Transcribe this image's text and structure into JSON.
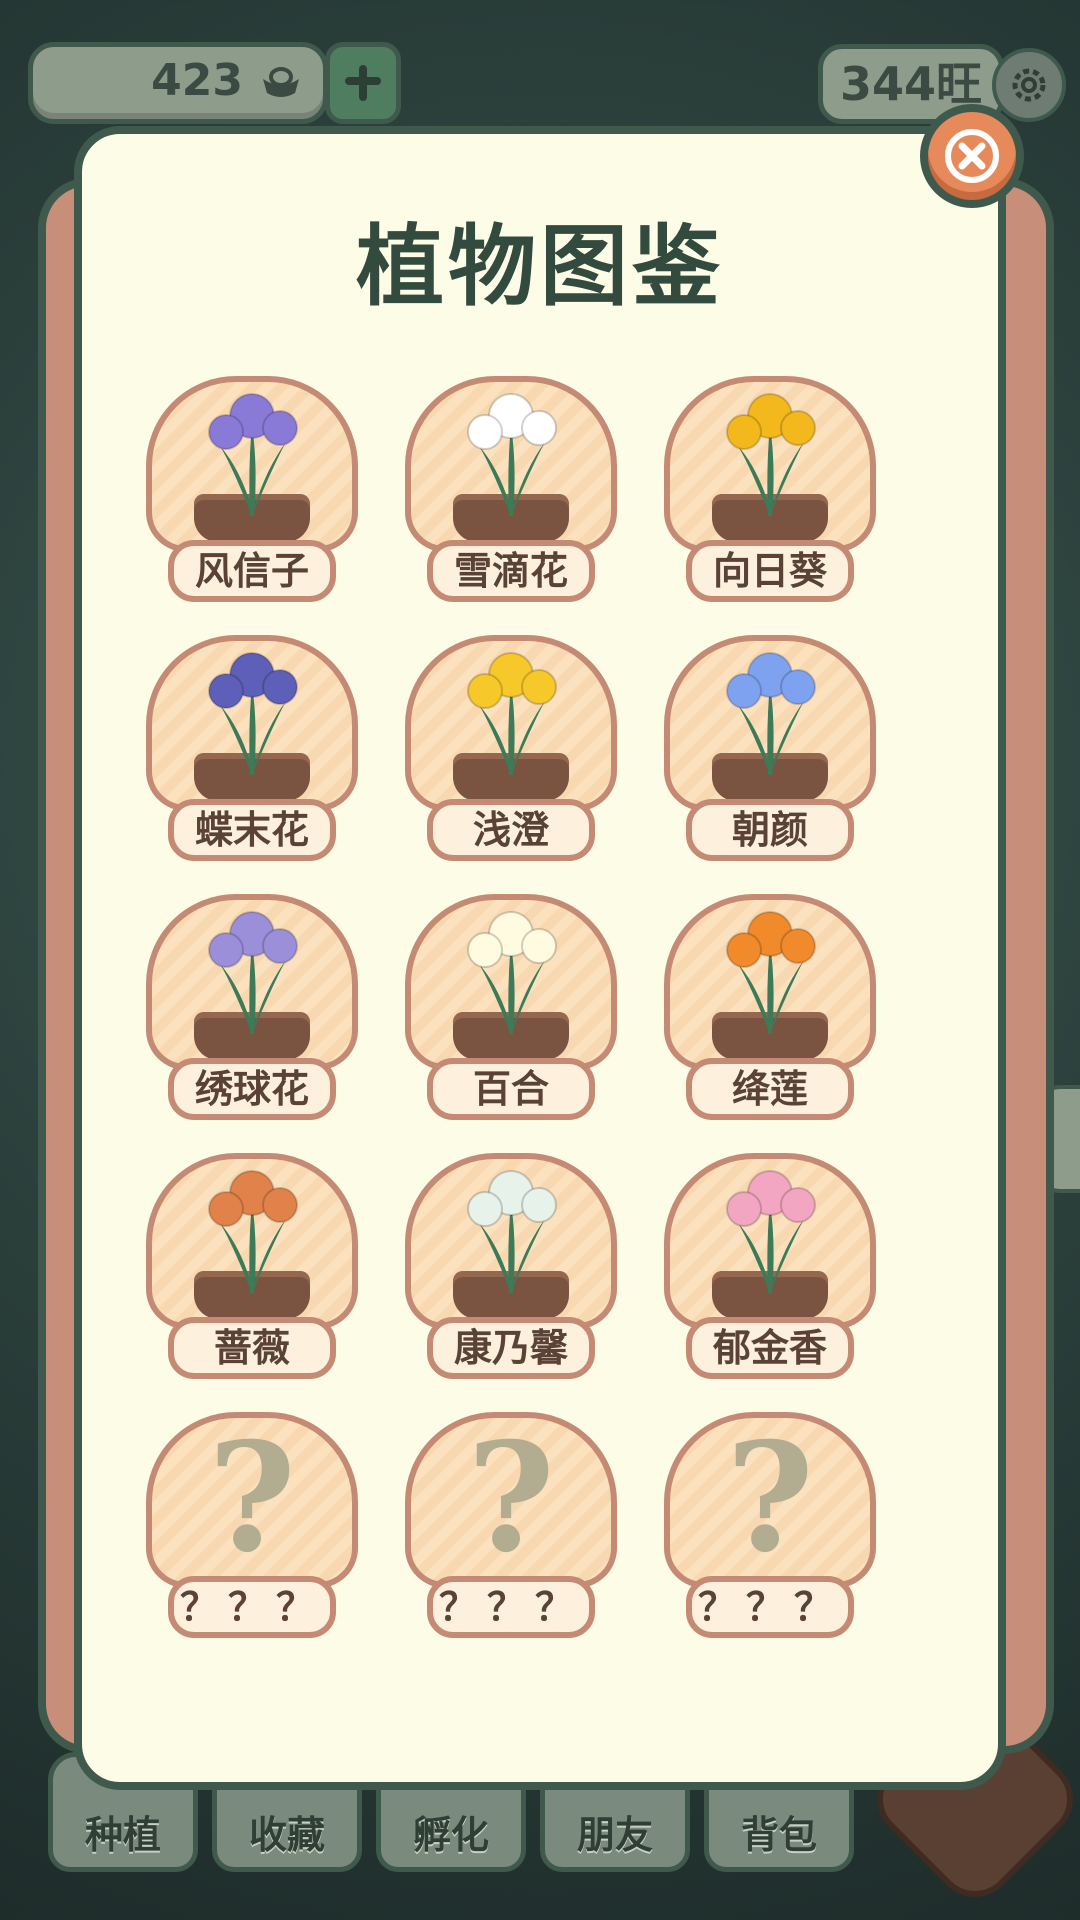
{
  "hud": {
    "currency_amount": "423",
    "currency_icon": "gold-ingot-icon",
    "score": "344旺"
  },
  "bottom_nav": [
    {
      "label": "种植",
      "icon": "plant-icon"
    },
    {
      "label": "收藏",
      "icon": "cabinet-icon"
    },
    {
      "label": "孵化",
      "icon": "egg-icon"
    },
    {
      "label": "朋友",
      "icon": "cat-icon"
    },
    {
      "label": "背包",
      "icon": "backpack-icon"
    }
  ],
  "modal": {
    "title": "植物图鉴",
    "close_icon": "close-icon",
    "plants": [
      {
        "name": "风信子",
        "icon": "hyacinth-icon",
        "color": "#8a7ad8"
      },
      {
        "name": "雪滴花",
        "icon": "snowdrop-icon",
        "color": "#ffffff"
      },
      {
        "name": "向日葵",
        "icon": "sunflower-icon",
        "color": "#f2b81c"
      },
      {
        "name": "蝶末花",
        "icon": "iris-icon",
        "color": "#5d5fb8"
      },
      {
        "name": "浅澄",
        "icon": "yellow-flower-icon",
        "color": "#f6c82a"
      },
      {
        "name": "朝颜",
        "icon": "morning-glory-icon",
        "color": "#7fa2f0"
      },
      {
        "name": "绣球花",
        "icon": "hydrangea-icon",
        "color": "#9a8fd8"
      },
      {
        "name": "百合",
        "icon": "lily-icon",
        "color": "#fffbe0"
      },
      {
        "name": "绛莲",
        "icon": "orange-lotus-icon",
        "color": "#f08a2a"
      },
      {
        "name": "蔷薇",
        "icon": "rose-icon",
        "color": "#e0824a"
      },
      {
        "name": "康乃馨",
        "icon": "carnation-icon",
        "color": "#e6f2ea"
      },
      {
        "name": "郁金香",
        "icon": "tulip-icon",
        "color": "#f2a6c2"
      },
      {
        "name": "？？？",
        "icon": "question-icon",
        "locked": true
      },
      {
        "name": "？？？",
        "icon": "question-icon",
        "locked": true
      },
      {
        "name": "？？？",
        "icon": "question-icon",
        "locked": true
      }
    ]
  }
}
